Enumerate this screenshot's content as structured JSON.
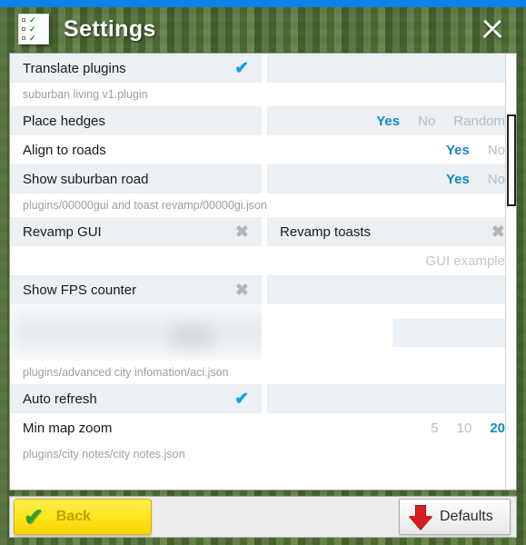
{
  "window": {
    "title": "Settings",
    "icon": "checklist-icon",
    "close_icon": "close-icon",
    "accent_blue": "#0a84e8",
    "selected_blue": "#1787c8",
    "check_blue": "#14a0e6"
  },
  "rows": [
    {
      "type": "setting",
      "left": {
        "label": "Translate plugins",
        "control": "check",
        "state": "on"
      },
      "right": {
        "label": "",
        "control": "none"
      }
    },
    {
      "type": "path",
      "path": "suburban living v1.plugin"
    },
    {
      "type": "setting",
      "left": {
        "label": "Place hedges",
        "control": "options"
      },
      "options": [
        {
          "label": "Yes",
          "selected": true
        },
        {
          "label": "No",
          "selected": false
        },
        {
          "label": "Random",
          "selected": false
        }
      ]
    },
    {
      "type": "setting",
      "left": {
        "label": "Align to roads",
        "control": "options"
      },
      "options": [
        {
          "label": "Yes",
          "selected": true
        },
        {
          "label": "No",
          "selected": false
        }
      ]
    },
    {
      "type": "setting",
      "left": {
        "label": "Show suburban road",
        "control": "options"
      },
      "options": [
        {
          "label": "Yes",
          "selected": true
        },
        {
          "label": "No",
          "selected": false
        }
      ]
    },
    {
      "type": "path",
      "path": "plugins/00000gui and toast revamp/00000gi.json"
    },
    {
      "type": "setting",
      "left": {
        "label": "Revamp GUI",
        "control": "xmark",
        "state": "off"
      },
      "right": {
        "label": "Revamp toasts",
        "control": "xmark",
        "state": "off"
      }
    },
    {
      "type": "setting",
      "left": {
        "label": "",
        "control": "none"
      },
      "right": {
        "label": "GUI example",
        "control": "hint"
      }
    },
    {
      "type": "setting",
      "left": {
        "label": "Show FPS counter",
        "control": "xmark",
        "state": "off"
      },
      "right": {
        "label": "",
        "control": "none"
      }
    },
    {
      "type": "blurred"
    },
    {
      "type": "path",
      "path": "plugins/advanced city infomation/aci.json"
    },
    {
      "type": "setting",
      "left": {
        "label": "Auto refresh",
        "control": "check",
        "state": "on"
      },
      "right": {
        "label": "",
        "control": "none"
      }
    },
    {
      "type": "setting",
      "left": {
        "label": "Min map zoom",
        "control": "options"
      },
      "options": [
        {
          "label": "5",
          "selected": false
        },
        {
          "label": "10",
          "selected": false
        },
        {
          "label": "20",
          "selected": true
        }
      ]
    },
    {
      "type": "path",
      "path": "plugins/city notes/city notes.json"
    }
  ],
  "scrollbar": {
    "thumb_top_pct": 14,
    "thumb_height_pct": 21
  },
  "footer": {
    "back_label": "Back",
    "back_icon": "green-check-icon",
    "defaults_label": "Defaults",
    "defaults_icon": "red-down-arrow-icon"
  }
}
